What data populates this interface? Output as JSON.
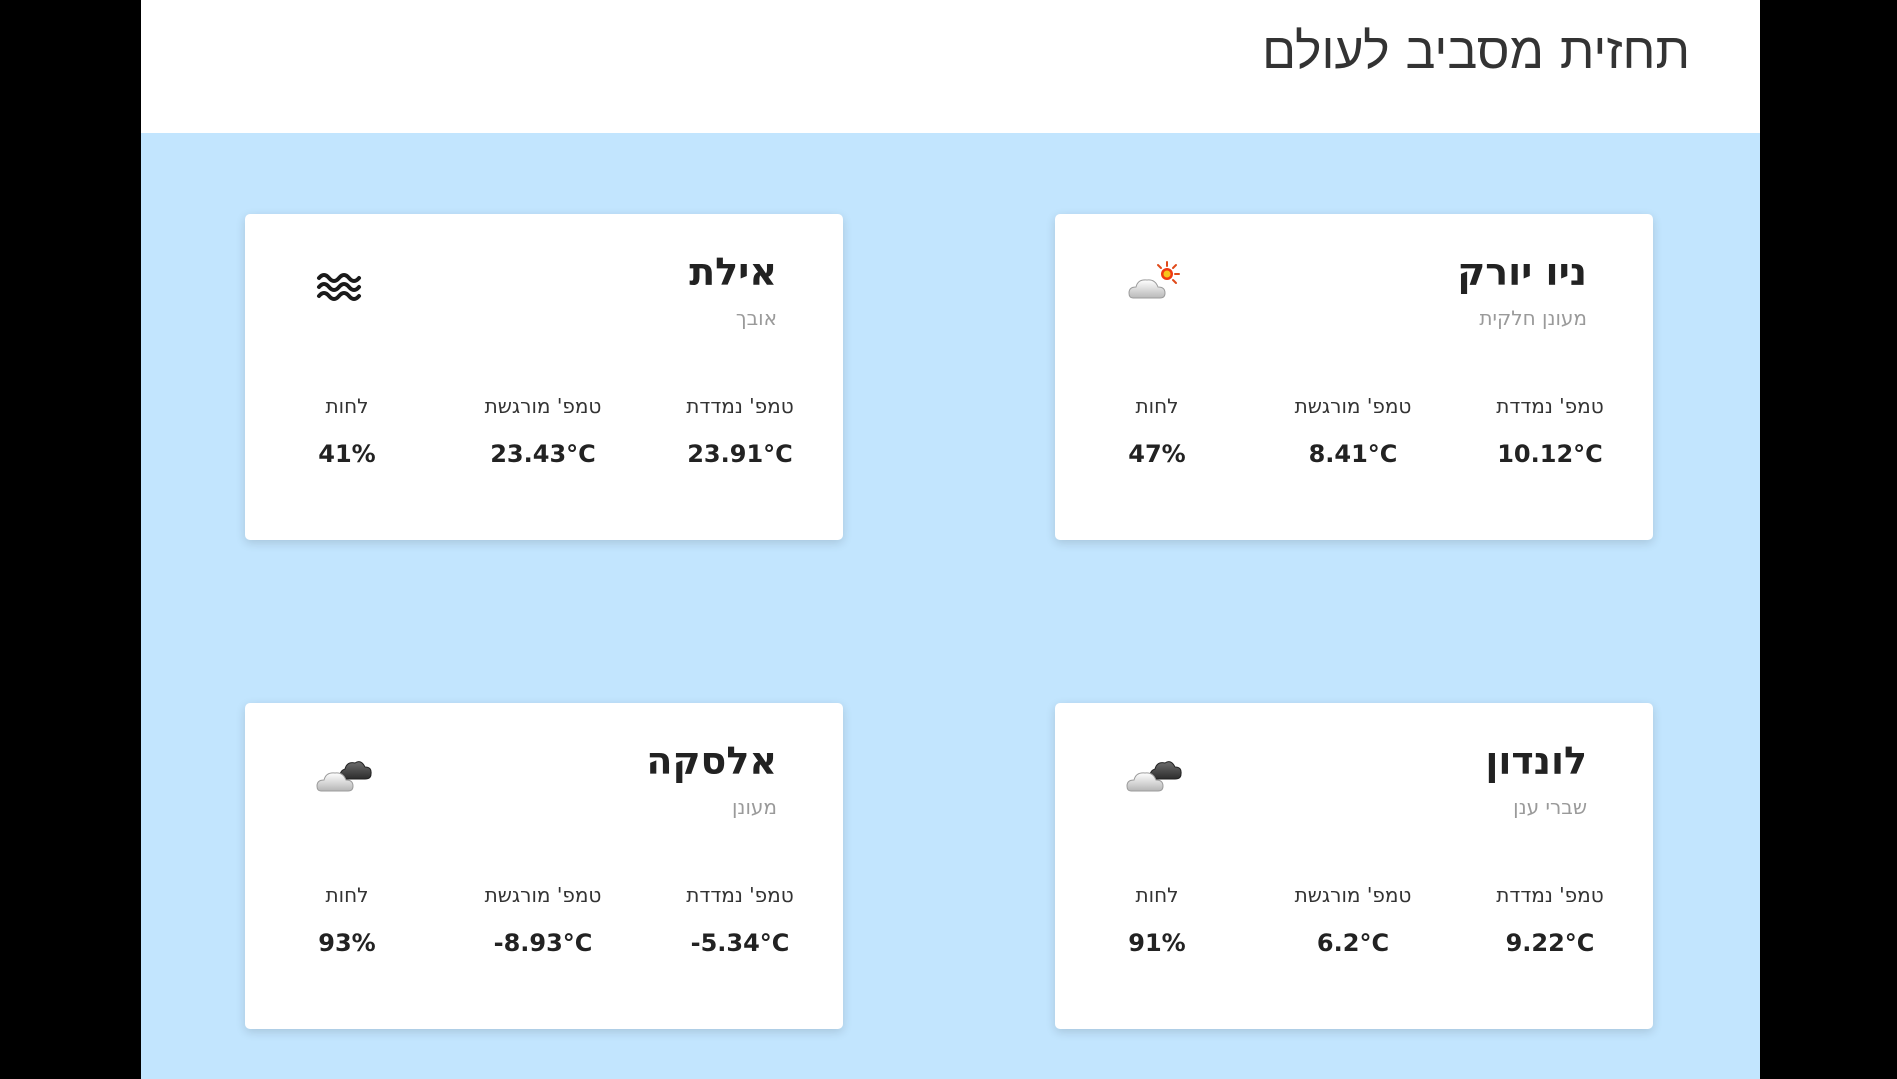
{
  "header": {
    "title": "תחזית מסביב לעולם"
  },
  "cards": [
    {
      "city": "ניו יורק",
      "condition": "מעונן חלקית",
      "icon": "partly-cloudy-icon",
      "temp_label": "טמפ' נמדדת",
      "temp_value": "10.12°C",
      "feels_label": "טמפ' מורגשת",
      "feels_value": "8.41°C",
      "humidity_label": "לחות",
      "humidity_value": "47%"
    },
    {
      "city": "אילת",
      "condition": "אובך",
      "icon": "haze-icon",
      "temp_label": "טמפ' נמדדת",
      "temp_value": "23.91°C",
      "feels_label": "טמפ' מורגשת",
      "feels_value": "23.43°C",
      "humidity_label": "לחות",
      "humidity_value": "41%"
    },
    {
      "city": "לונדון",
      "condition": "שברי ענן",
      "icon": "broken-clouds-icon",
      "temp_label": "טמפ' נמדדת",
      "temp_value": "9.22°C",
      "feels_label": "טמפ' מורגשת",
      "feels_value": "6.2°C",
      "humidity_label": "לחות",
      "humidity_value": "91%"
    },
    {
      "city": "אלסקה",
      "condition": "מעונן",
      "icon": "overcast-clouds-icon",
      "temp_label": "טמפ' נמדדת",
      "temp_value": "5.34°C-",
      "feels_label": "טמפ' מורגשת",
      "feels_value": "8.93°C-",
      "humidity_label": "לחות",
      "humidity_value": "93%"
    }
  ],
  "colors": {
    "page_background": "#c2e5fe",
    "header_background": "#ffffff",
    "card_background": "#ffffff",
    "muted_text": "#9a9a9a"
  }
}
